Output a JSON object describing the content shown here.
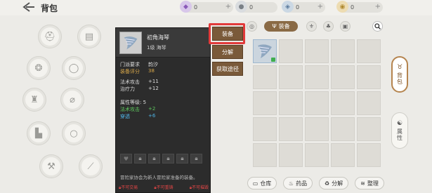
{
  "header": {
    "title": "背包",
    "currencies": [
      {
        "icon": "purple-crystal-icon",
        "value": "0",
        "color": "#8a5ab8"
      },
      {
        "icon": "silver-coin-icon",
        "value": "0",
        "color": "#9aa0a6"
      },
      {
        "icon": "blue-gem-icon",
        "value": "0",
        "color": "#6f8fb0"
      },
      {
        "icon": "gold-coin-icon",
        "value": "0",
        "color": "#c9a24a"
      }
    ]
  },
  "tooltip": {
    "item_name": "初角海琴",
    "item_level": "1级 海琴",
    "sect_label": "门派要求",
    "sect_value": "韵汐",
    "score_label": "装备评分",
    "score_value": "38",
    "spell_atk_label": "法术攻击",
    "spell_atk_value": "+11",
    "heal_label": "治疗力",
    "heal_value": "+12",
    "attr_level_label": "属性等级: 5",
    "attr1_label": "法术攻击",
    "attr1_value": "+2",
    "attr2_label": "穿透",
    "attr2_value": "+6",
    "description": "冒险家协会为新人冒险家准备的装备。",
    "flags": [
      "不可交易",
      "不可重铸",
      "不可摧毁"
    ]
  },
  "actions": {
    "equip": "装备",
    "decompose": "分解",
    "obtain": "获取途径"
  },
  "filters": {
    "active_label": "装备"
  },
  "bottom": {
    "warehouse": "仓库",
    "medicine": "药品",
    "decompose": "分解",
    "sort": "整理"
  },
  "sidebar": {
    "bag": "背包",
    "attributes": "属性"
  },
  "colors": {
    "accent": "#8a6a45",
    "highlight": "#e23a3a",
    "tooltip_green": "#5ec95e",
    "tooltip_blue": "#4fb5e6",
    "tooltip_gold": "#d9a84a"
  }
}
